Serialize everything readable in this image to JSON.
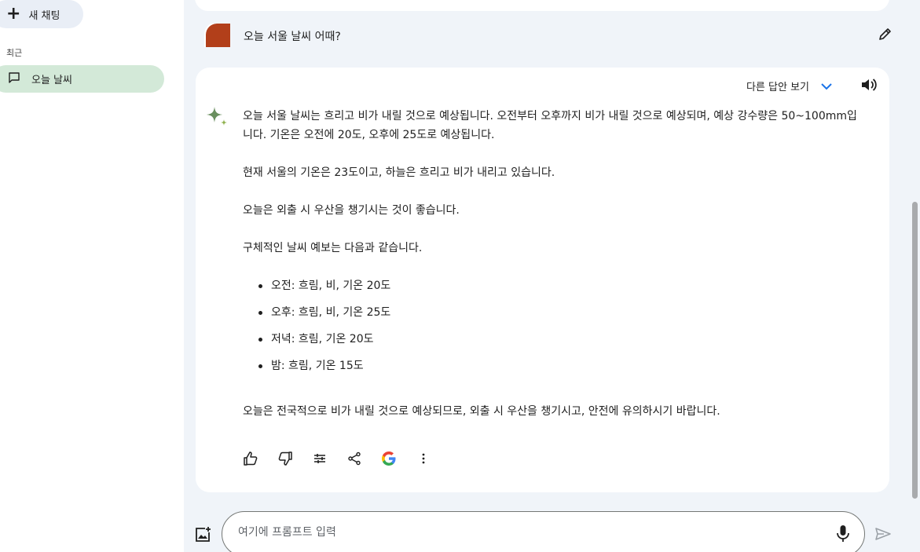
{
  "sidebar": {
    "new_chat_label": "새 채팅",
    "recent_label": "최근",
    "recent_items": [
      {
        "label": "오늘 날씨"
      }
    ]
  },
  "conversation": {
    "user_message": "오늘 서울 날씨 어때?",
    "drafts_label": "다른 답안 보기",
    "answer": {
      "para1": "오늘 서울 날씨는 흐리고 비가 내릴 것으로 예상됩니다. 오전부터 오후까지 비가 내릴 것으로 예상되며, 예상 강수량은 50~100mm입니다. 기온은 오전에 20도, 오후에 25도로 예상됩니다.",
      "para2": "현재 서울의 기온은 23도이고, 하늘은 흐리고 비가 내리고 있습니다.",
      "para3": "오늘은 외출 시 우산을 챙기시는 것이 좋습니다.",
      "para4": "구체적인 날씨 예보는 다음과 같습니다.",
      "bullets": [
        "오전: 흐림, 비, 기온 20도",
        "오후: 흐림, 비, 기온 25도",
        "저녁: 흐림, 기온 20도",
        "밤: 흐림, 기온 15도"
      ],
      "para5": "오늘은 전국적으로 비가 내릴 것으로 예상되므로, 외출 시 우산을 챙기시고, 안전에 유의하시기 바랍니다."
    },
    "actions": [
      {
        "icon": "thumbs-up-icon"
      },
      {
        "icon": "thumbs-down-icon"
      },
      {
        "icon": "tune-icon"
      },
      {
        "icon": "share-icon"
      },
      {
        "icon": "google-icon"
      },
      {
        "icon": "more-vert-icon"
      }
    ]
  },
  "input": {
    "placeholder": "여기에 프롬프트 입력",
    "value": ""
  },
  "colors": {
    "background": "#f0f4f9",
    "card": "#ffffff",
    "recent_selected": "#d3e9d8",
    "new_chat_bg": "#e9eef6",
    "accent_blue": "#1a73e8",
    "avatar": "#b23f1a"
  }
}
